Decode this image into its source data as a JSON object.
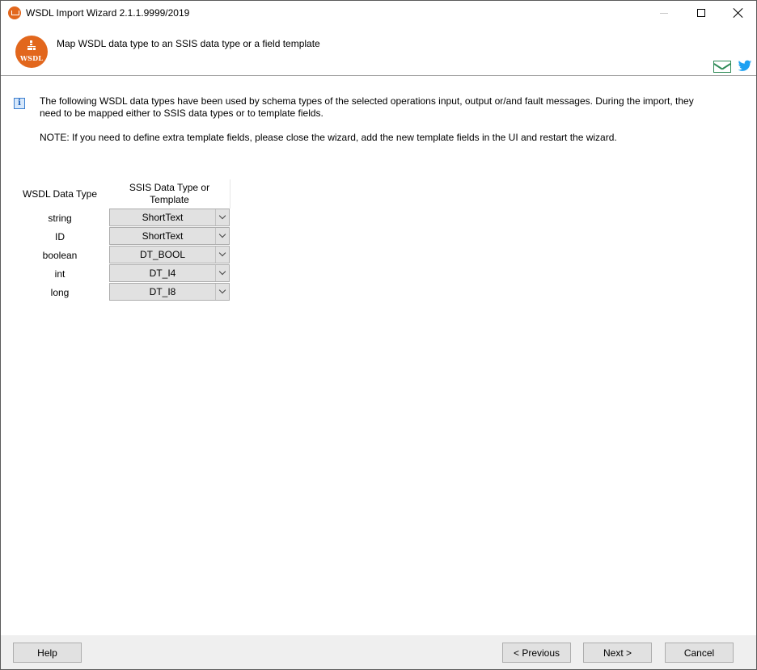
{
  "window": {
    "title": "WSDL Import Wizard 2.1.1.9999/2019"
  },
  "header": {
    "logo_text": "WSDL",
    "title": "Map WSDL data type to an SSIS data type or a field template",
    "icons": [
      "mail-icon",
      "twitter-icon"
    ]
  },
  "info": {
    "description": "The following WSDL data types have been used by schema types of the selected operations input, output or/and fault messages. During the import, they need to be mapped either to SSIS data types or to template fields.",
    "note": "NOTE: If you need to define extra template fields, please close the wizard, add the new template fields in the UI and restart the wizard."
  },
  "grid": {
    "col_wsdl": "WSDL Data Type",
    "col_ssis": "SSIS Data Type or Template",
    "rows": [
      {
        "wsdl": "string",
        "ssis": "ShortText"
      },
      {
        "wsdl": "ID",
        "ssis": "ShortText"
      },
      {
        "wsdl": "boolean",
        "ssis": "DT_BOOL"
      },
      {
        "wsdl": "int",
        "ssis": "DT_I4"
      },
      {
        "wsdl": "long",
        "ssis": "DT_I8"
      }
    ]
  },
  "footer": {
    "help": "Help",
    "previous": "< Previous",
    "next": "Next >",
    "cancel": "Cancel"
  },
  "colors": {
    "accent": "#e2671d",
    "mail": "#2e8b57",
    "twitter": "#1da1f2",
    "info": "#3b7fd0"
  }
}
